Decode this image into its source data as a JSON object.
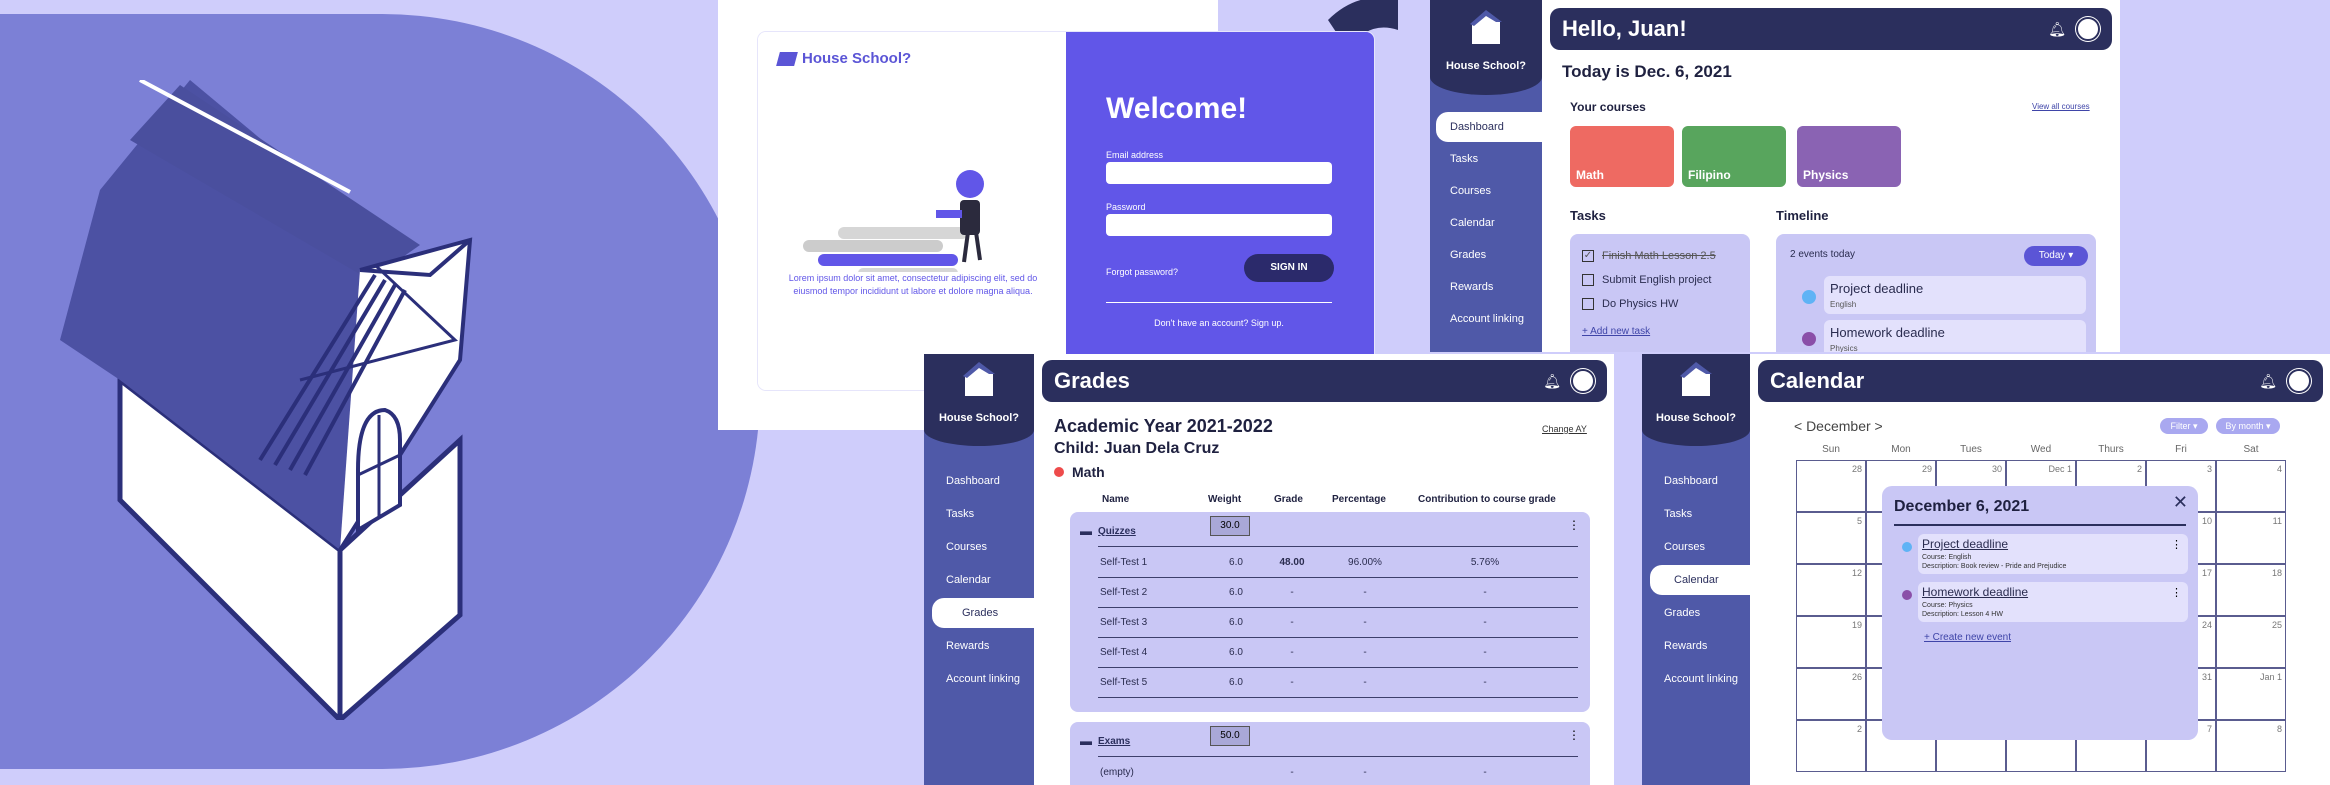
{
  "login": {
    "brand": "House School?",
    "lorem": "Lorem ipsum dolor sit amet, consectetur adipiscing elit, sed do eiusmod tempor incididunt ut labore et dolore magna aliqua.",
    "welcome": "Welcome!",
    "email_label": "Email address",
    "password_label": "Password",
    "forgot": "Forgot password?",
    "signin": "SIGN IN",
    "signup": "Don't have an account? Sign up."
  },
  "sidebar_brand": "House School?",
  "nav": [
    "Dashboard",
    "Tasks",
    "Courses",
    "Calendar",
    "Grades",
    "Rewards",
    "Account linking"
  ],
  "dashboard": {
    "greeting": "Hello, Juan!",
    "today": "Today is Dec. 6, 2021",
    "courses_title": "Your courses",
    "view_all": "View all courses",
    "courses": [
      {
        "name": "Math",
        "color": "#ee6a62"
      },
      {
        "name": "Filipino",
        "color": "#58a55d"
      },
      {
        "name": "Physics",
        "color": "#8a63b3"
      }
    ],
    "tasks_title": "Tasks",
    "tasks": [
      {
        "label": "Finish Math Lesson 2.5",
        "done": true
      },
      {
        "label": "Submit English project",
        "done": false
      },
      {
        "label": "Do Physics HW",
        "done": false
      }
    ],
    "add_task": "+ Add new task",
    "timeline_title": "Timeline",
    "events_today": "2 events today",
    "today_btn": "Today ▾",
    "timeline": [
      {
        "title": "Project deadline",
        "sub": "English",
        "color": "#5fb3f5"
      },
      {
        "title": "Homework deadline",
        "sub": "Physics",
        "color": "#8a4fa8"
      }
    ]
  },
  "grades": {
    "title": "Grades",
    "year": "Academic Year 2021-2022",
    "child": "Child: Juan Dela Cruz",
    "course": "Math",
    "change": "Change AY",
    "headers": [
      "Name",
      "Weight",
      "Grade",
      "Percentage",
      "Contribution to course grade"
    ],
    "group1": {
      "name": "Quizzes",
      "weight": "30.0"
    },
    "rows": [
      [
        "Self-Test 1",
        "6.0",
        "48.00",
        "96.00%",
        "5.76%"
      ],
      [
        "Self-Test 2",
        "6.0",
        "-",
        "-",
        "-"
      ],
      [
        "Self-Test 3",
        "6.0",
        "-",
        "-",
        "-"
      ],
      [
        "Self-Test 4",
        "6.0",
        "-",
        "-",
        "-"
      ],
      [
        "Self-Test 5",
        "6.0",
        "-",
        "-",
        "-"
      ]
    ],
    "group2": {
      "name": "Exams",
      "weight": "50.0"
    },
    "empty_row": [
      "(empty)",
      "",
      "-",
      "-",
      "-"
    ]
  },
  "calendar": {
    "title": "Calendar",
    "month": "< December >",
    "filter": "Filter ▾",
    "by_month": "By month ▾",
    "days": [
      "Sun",
      "Mon",
      "Tues",
      "Wed",
      "Thurs",
      "Fri",
      "Sat"
    ],
    "weeks": [
      [
        "28",
        "29",
        "30",
        "Dec 1",
        "2",
        "3",
        "4"
      ],
      [
        "5",
        "",
        "",
        "",
        "",
        "10",
        "11"
      ],
      [
        "12",
        "",
        "",
        "",
        "",
        "17",
        "18"
      ],
      [
        "19",
        "",
        "",
        "",
        "",
        "24",
        "25"
      ],
      [
        "26",
        "",
        "",
        "",
        "",
        "31",
        "Jan 1"
      ],
      [
        "2",
        "",
        "",
        "",
        "",
        "7",
        "8"
      ]
    ],
    "popup_title": "December 6, 2021",
    "events": [
      {
        "title": "Project deadline",
        "course": "Course: English",
        "desc": "Description: Book review - Pride and Prejudice",
        "color": "#5fb3f5"
      },
      {
        "title": "Homework deadline",
        "course": "Course: Physics",
        "desc": "Description: Lesson 4 HW",
        "color": "#8a4fa8"
      }
    ],
    "create": "+ Create new event"
  }
}
